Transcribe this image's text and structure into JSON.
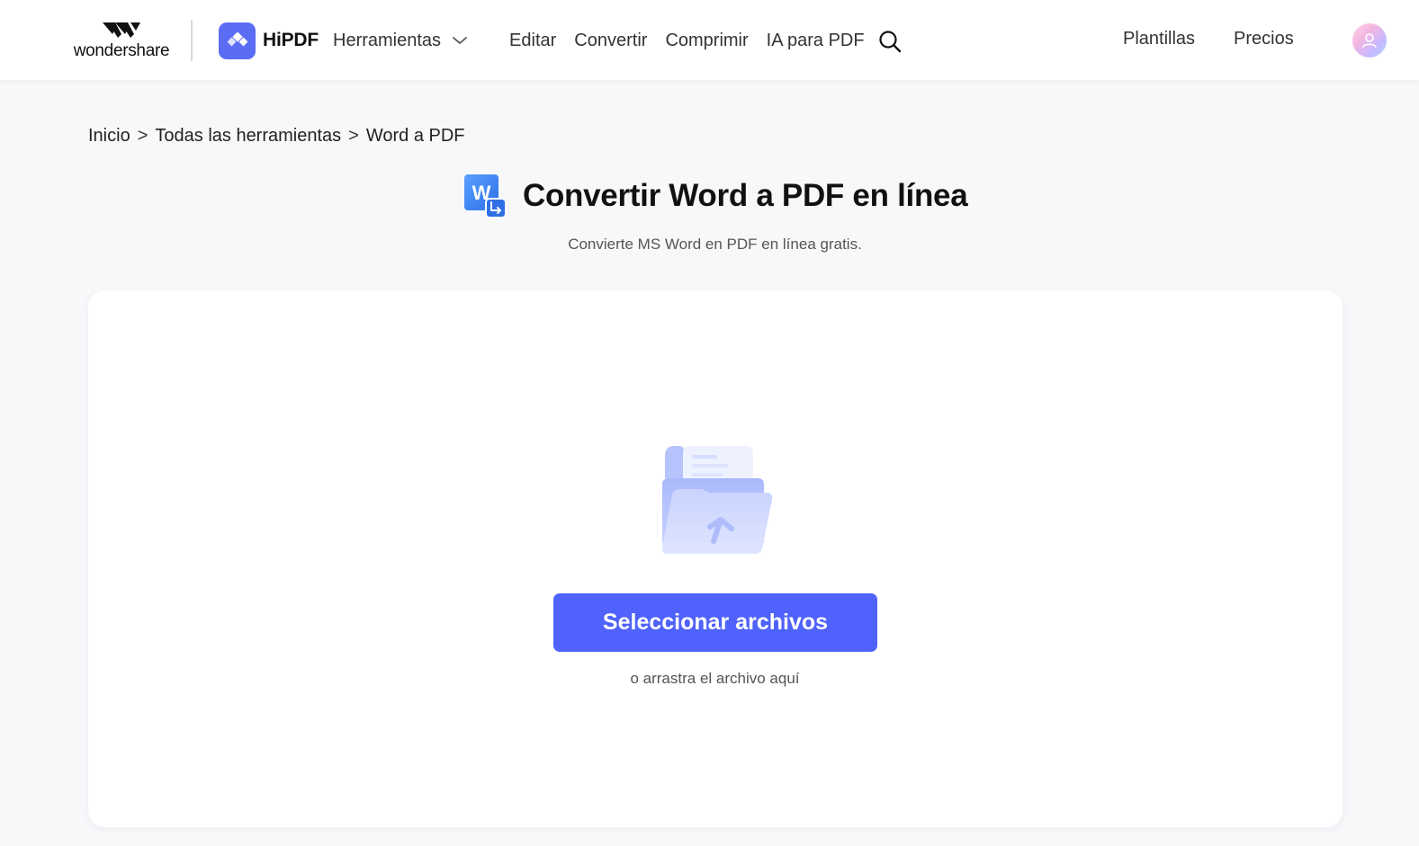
{
  "header": {
    "brand_text": "wondershare",
    "product_name": "HiPDF",
    "nav": {
      "tools_label": "Herramientas",
      "edit_label": "Editar",
      "convert_label": "Convertir",
      "compress_label": "Comprimir",
      "ai_label": "IA para PDF"
    },
    "templates_label": "Plantillas",
    "pricing_label": "Precios",
    "icons": {
      "tools_dropdown": "chevron-down-icon",
      "search": "search-icon",
      "avatar": "user-icon"
    }
  },
  "breadcrumb": {
    "items": [
      "Inicio",
      "Todas las herramientas",
      "Word a PDF"
    ],
    "separator": ">"
  },
  "page": {
    "title": "Convertir Word a PDF en línea",
    "subtitle": "Convierte MS Word en PDF en línea gratis.",
    "title_icon": "word-to-pdf-icon"
  },
  "upload": {
    "illustration": "upload-folder-icon",
    "button_label": "Seleccionar archivos",
    "drag_hint": "o arrastra el archivo aquí"
  },
  "colors": {
    "accent": "#4f62fb",
    "brand_mark": "#5b6cf5",
    "background": "#f7f8fa",
    "card": "#ffffff"
  }
}
